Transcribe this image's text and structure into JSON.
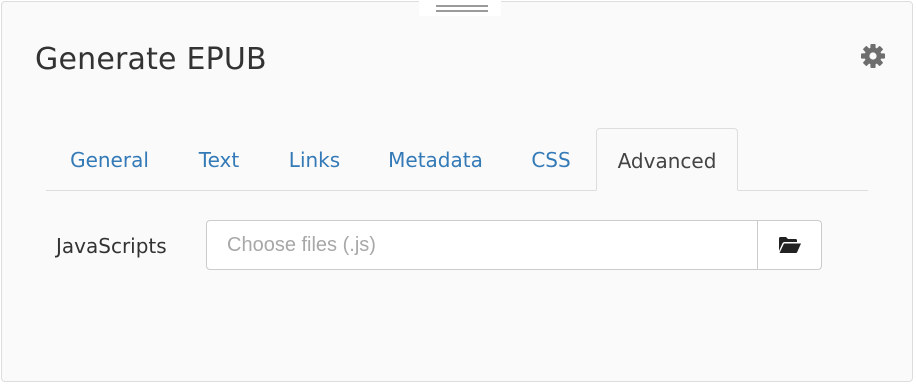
{
  "panel": {
    "title": "Generate EPUB",
    "settings_icon": "gear-icon",
    "drag_handle_icon": "drag-handle-icon"
  },
  "tabs": [
    {
      "label": "General",
      "active": false
    },
    {
      "label": "Text",
      "active": false
    },
    {
      "label": "Links",
      "active": false
    },
    {
      "label": "Metadata",
      "active": false
    },
    {
      "label": "CSS",
      "active": false
    },
    {
      "label": "Advanced",
      "active": true
    }
  ],
  "advanced": {
    "javascripts_label": "JavaScripts",
    "javascripts_placeholder": "Choose files (.js)",
    "javascripts_value": "",
    "browse_icon": "folder-open-icon"
  },
  "colors": {
    "link": "#337ab7",
    "text": "#333333",
    "panel_bg": "#fafafa",
    "border": "#dddddd"
  }
}
